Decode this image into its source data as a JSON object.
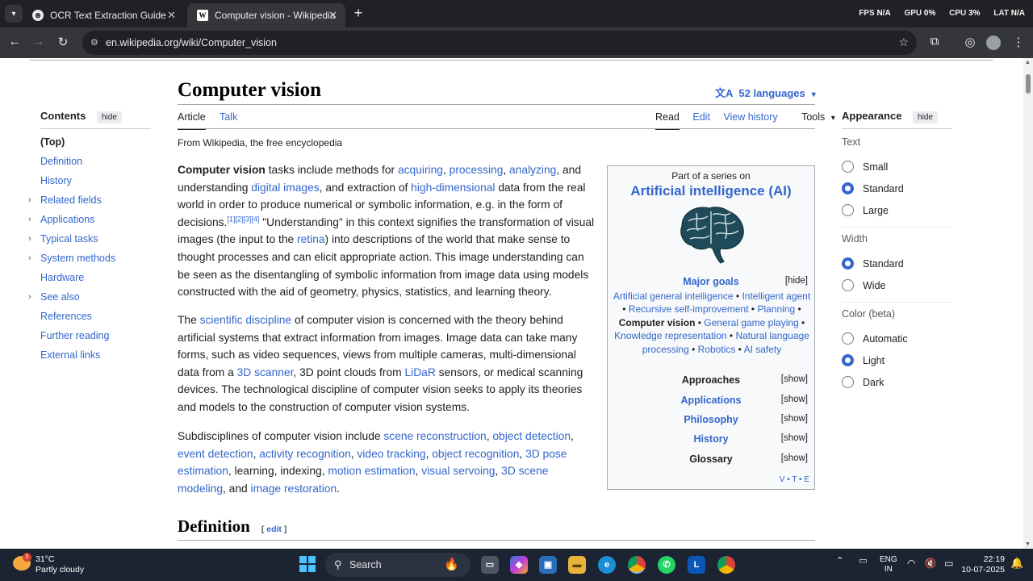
{
  "browser": {
    "tabs": [
      {
        "title": "OCR Text Extraction Guide",
        "active": false
      },
      {
        "title": "Computer vision - Wikipedia",
        "active": true
      }
    ],
    "new_tab": "+",
    "perf": {
      "fps_label": "FPS",
      "fps": "N/A",
      "gpu_label": "GPU",
      "gpu": "0%",
      "cpu_label": "CPU",
      "cpu": "3%",
      "lat_label": "LAT",
      "lat": "N/A"
    },
    "url": "en.wikipedia.org/wiki/Computer_vision"
  },
  "toc": {
    "heading": "Contents",
    "hide": "hide",
    "items": [
      {
        "label": "(Top)",
        "expandable": false
      },
      {
        "label": "Definition",
        "expandable": false
      },
      {
        "label": "History",
        "expandable": false
      },
      {
        "label": "Related fields",
        "expandable": true
      },
      {
        "label": "Applications",
        "expandable": true
      },
      {
        "label": "Typical tasks",
        "expandable": true
      },
      {
        "label": "System methods",
        "expandable": true
      },
      {
        "label": "Hardware",
        "expandable": false
      },
      {
        "label": "See also",
        "expandable": true
      },
      {
        "label": "References",
        "expandable": false
      },
      {
        "label": "Further reading",
        "expandable": false
      },
      {
        "label": "External links",
        "expandable": false
      }
    ]
  },
  "article": {
    "title": "Computer vision",
    "languages": "52 languages",
    "tabs_left": [
      "Article",
      "Talk"
    ],
    "tabs_right": [
      "Read",
      "Edit",
      "View history",
      "Tools"
    ],
    "tagline": "From Wikipedia, the free encyclopedia",
    "p1": [
      {
        "t": "Computer vision",
        "k": "b"
      },
      {
        "t": " tasks include methods for "
      },
      {
        "t": "acquiring",
        "k": "a"
      },
      {
        "t": ", "
      },
      {
        "t": "processing",
        "k": "a"
      },
      {
        "t": ", "
      },
      {
        "t": "analyzing",
        "k": "a"
      },
      {
        "t": ", and understanding "
      },
      {
        "t": "digital images",
        "k": "a"
      },
      {
        "t": ", and extraction of "
      },
      {
        "t": "high-dimensional",
        "k": "a"
      },
      {
        "t": " data from the real world in order to produce numerical or symbolic information, e.g. in the form of decisions."
      },
      {
        "t": "[1][2][3][4]",
        "k": "s"
      },
      {
        "t": " \"Understanding\" in this context signifies the transformation of visual images (the input to the "
      },
      {
        "t": "retina",
        "k": "a"
      },
      {
        "t": ") into descriptions of the world that make sense to thought processes and can elicit appropriate action. This image understanding can be seen as the disentangling of symbolic information from image data using models constructed with the aid of geometry, physics, statistics, and learning theory."
      }
    ],
    "p2": [
      {
        "t": "The "
      },
      {
        "t": "scientific discipline",
        "k": "a"
      },
      {
        "t": " of computer vision is concerned with the theory behind artificial systems that extract information from images. Image data can take many forms, such as video sequences, views from multiple cameras, multi-dimensional data from a "
      },
      {
        "t": "3D scanner",
        "k": "a"
      },
      {
        "t": ", 3D point clouds from "
      },
      {
        "t": "LiDaR",
        "k": "a"
      },
      {
        "t": " sensors, or medical scanning devices. The technological discipline of computer vision seeks to apply its theories and models to the construction of computer vision systems."
      }
    ],
    "p3": [
      {
        "t": "Subdisciplines of computer vision include "
      },
      {
        "t": "scene reconstruction",
        "k": "a"
      },
      {
        "t": ", "
      },
      {
        "t": "object detection",
        "k": "a"
      },
      {
        "t": ", "
      },
      {
        "t": "event detection",
        "k": "a"
      },
      {
        "t": ", "
      },
      {
        "t": "activity recognition",
        "k": "a"
      },
      {
        "t": ", "
      },
      {
        "t": "video tracking",
        "k": "a"
      },
      {
        "t": ", "
      },
      {
        "t": "object recognition",
        "k": "a"
      },
      {
        "t": ", "
      },
      {
        "t": "3D pose estimation",
        "k": "a"
      },
      {
        "t": ", learning, indexing, "
      },
      {
        "t": "motion estimation",
        "k": "a"
      },
      {
        "t": ", "
      },
      {
        "t": "visual servoing",
        "k": "a"
      },
      {
        "t": ", "
      },
      {
        "t": "3D scene modeling",
        "k": "a"
      },
      {
        "t": ", and "
      },
      {
        "t": "image restoration",
        "k": "a"
      },
      {
        "t": "."
      }
    ],
    "section": {
      "title": "Definition",
      "edit": "edit"
    }
  },
  "infobox": {
    "part_of": "Part of a series on",
    "title": "Artificial intelligence (AI)",
    "goals_heading": "Major goals",
    "goals_toggle": "[hide]",
    "goals": [
      {
        "t": "Artificial general intelligence",
        "k": "a"
      },
      {
        "t": " • "
      },
      {
        "t": "Intelligent agent",
        "k": "a"
      },
      {
        "t": " • "
      },
      {
        "t": "Recursive self-improvement",
        "k": "a"
      },
      {
        "t": " • "
      },
      {
        "t": "Planning",
        "k": "a"
      },
      {
        "t": " • "
      },
      {
        "t": "Computer vision",
        "k": "b"
      },
      {
        "t": " • "
      },
      {
        "t": "General game playing",
        "k": "a"
      },
      {
        "t": " • "
      },
      {
        "t": "Knowledge representation",
        "k": "a"
      },
      {
        "t": " • "
      },
      {
        "t": "Natural language processing",
        "k": "a"
      },
      {
        "t": " • "
      },
      {
        "t": "Robotics",
        "k": "a"
      },
      {
        "t": " • "
      },
      {
        "t": "AI safety",
        "k": "a"
      }
    ],
    "sections": [
      {
        "label": "Approaches",
        "toggle": "[show]",
        "link": false
      },
      {
        "label": "Applications",
        "toggle": "[show]",
        "link": true
      },
      {
        "label": "Philosophy",
        "toggle": "[show]",
        "link": true
      },
      {
        "label": "History",
        "toggle": "[show]",
        "link": true
      },
      {
        "label": "Glossary",
        "toggle": "[show]",
        "link": false
      }
    ],
    "vte": "V • T • E"
  },
  "appearance": {
    "heading": "Appearance",
    "hide": "hide",
    "text_label": "Text",
    "text_options": [
      {
        "label": "Small",
        "on": false
      },
      {
        "label": "Standard",
        "on": true
      },
      {
        "label": "Large",
        "on": false
      }
    ],
    "width_label": "Width",
    "width_options": [
      {
        "label": "Standard",
        "on": true
      },
      {
        "label": "Wide",
        "on": false
      }
    ],
    "color_label": "Color (beta)",
    "color_options": [
      {
        "label": "Automatic",
        "on": false
      },
      {
        "label": "Light",
        "on": true
      },
      {
        "label": "Dark",
        "on": false
      }
    ]
  },
  "taskbar": {
    "weather_temp": "31°C",
    "weather_desc": "Partly cloudy",
    "weather_badge": "5",
    "search": "Search",
    "lang_line1": "ENG",
    "lang_line2": "IN",
    "time": "22:19",
    "date": "10-07-2025"
  },
  "colors": {
    "link": "#3366cc",
    "chrome_dark": "#202124",
    "taskbar": "#1c2433"
  }
}
